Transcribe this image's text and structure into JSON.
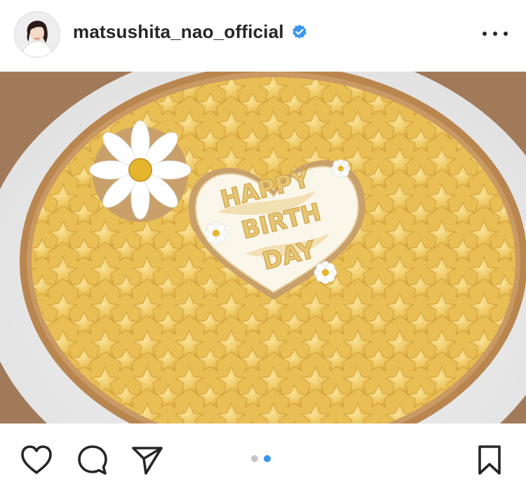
{
  "header": {
    "username": "matsushita_nao_official",
    "verified": true,
    "avatar_icon": "profile-photo",
    "more_icon": "more-options-icon"
  },
  "post": {
    "image_text_lines": [
      "HAPPY",
      "BIRTH",
      "DAY"
    ],
    "carousel": {
      "count": 2,
      "active_index": 1
    }
  },
  "actions": {
    "like_icon": "heart-icon",
    "comment_icon": "comment-icon",
    "share_icon": "paper-plane-icon",
    "save_icon": "bookmark-icon"
  },
  "colors": {
    "text": "#262626",
    "verified_blue": "#3897f0",
    "dot_active": "#3897f0",
    "dot_inactive": "#c7c7c7",
    "custard": "#f0c85a",
    "crust": "#b9864f"
  }
}
